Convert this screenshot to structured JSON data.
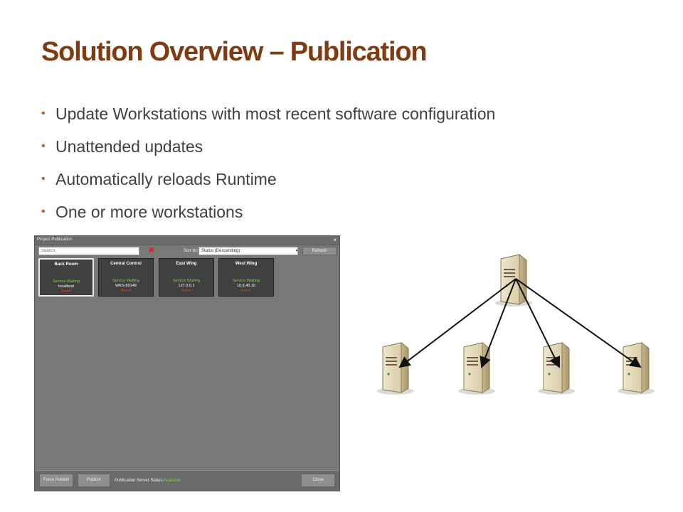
{
  "slide": {
    "title": "Solution Overview – Publication",
    "bullets": [
      "Update Workstations with most recent software configuration",
      "Unattended updates",
      "Automatically reloads Runtime",
      "One or more workstations"
    ]
  },
  "app": {
    "window_title": "Project Publication",
    "search": {
      "placeholder": "Search"
    },
    "sort": {
      "label": "Sort by:",
      "value": "Status (Descending)"
    },
    "refresh_label": "Refresh",
    "tiles": [
      {
        "name": "Back Room",
        "status": "Service Waiting",
        "host": "localhost",
        "last": "Never",
        "selected": true
      },
      {
        "name": "Central Control",
        "status": "Service Waiting",
        "host": "WKS-50148",
        "last": "Never",
        "selected": false
      },
      {
        "name": "East Wing",
        "status": "Service Waiting",
        "host": "127.0.0.1",
        "last": "Never",
        "selected": false
      },
      {
        "name": "West Wing",
        "status": "Service Waiting",
        "host": "10.6.40.10",
        "last": "Never",
        "selected": false
      }
    ],
    "footer": {
      "force_publish_label": "Force Publish",
      "publish_label": "Publish",
      "server_status_label": "Publication Server Status:",
      "server_status_value": "Available",
      "close_label": "Close"
    },
    "colors": {
      "background": "#787878",
      "tile": "#404040",
      "status_ok": "#7fd34a",
      "status_never": "#e23a2a",
      "title_accent": "#7f3b12"
    }
  },
  "diagram": {
    "server_icon": "server-icon",
    "client_count": 4
  }
}
